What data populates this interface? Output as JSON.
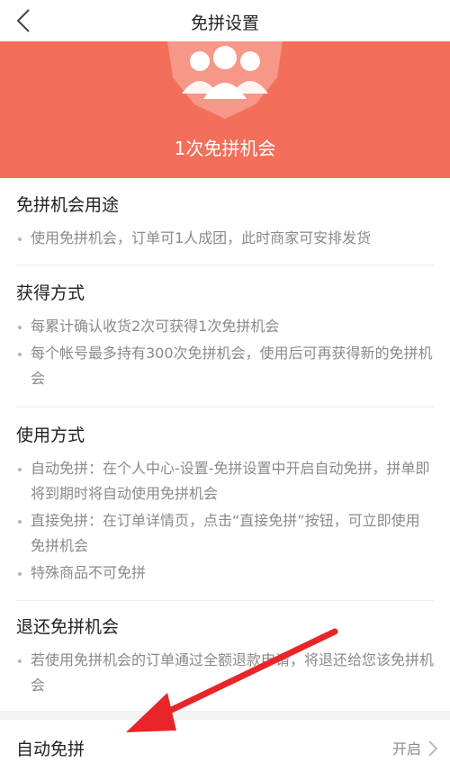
{
  "nav": {
    "title": "免拼设置"
  },
  "banner": {
    "text": "1次免拼机会"
  },
  "sections": [
    {
      "title": "免拼机会用途",
      "items": [
        "使用免拼机会，订单可1人成团，此时商家可安排发货"
      ]
    },
    {
      "title": "获得方式",
      "items": [
        "每累计确认收货2次可获得1次免拼机会",
        "每个帐号最多持有300次免拼机会，使用后可再获得新的免拼机会"
      ]
    },
    {
      "title": "使用方式",
      "items": [
        "自动免拼：在个人中心-设置-免拼设置中开启自动免拼，拼单即将到期时将自动使用免拼机会",
        "直接免拼：在订单详情页，点击“直接免拼”按钮，可立即使用免拼机会",
        "特殊商品不可免拼"
      ]
    },
    {
      "title": "退还免拼机会",
      "items": [
        "若使用免拼机会的订单通过全额退款申请，将退还给您该免拼机会"
      ]
    }
  ],
  "auto_row": {
    "label": "自动免拼",
    "value": "开启"
  },
  "colors": {
    "banner": "#f36f5a",
    "arrow": "#e8262a"
  }
}
